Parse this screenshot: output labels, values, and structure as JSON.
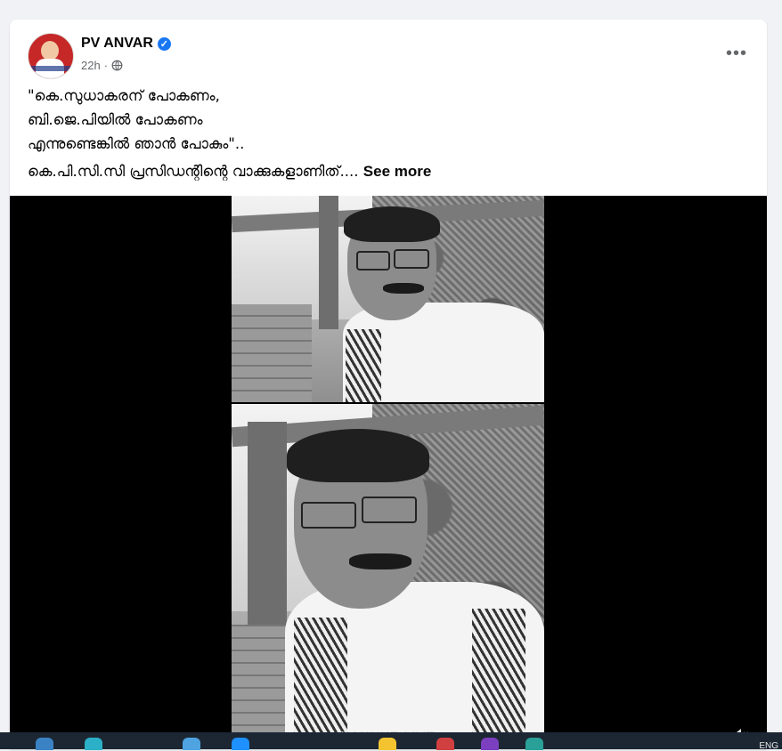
{
  "post": {
    "author": "PV ANVAR",
    "verified": true,
    "time": "22h",
    "privacy_icon": "globe-icon",
    "more_label": "•••",
    "text_lines": [
      "\"കെ.സുധാകരന് പോകണം,",
      "ബി.ജെ.പിയിൽ പോകണം",
      "എന്നുണ്ടെങ്കിൽ ഞാൻ പോകും\".."
    ],
    "text_last": "കെ.പി.സി.സി പ്രസിഡന്റിന്റെ വാക്കുകളാണിത്....",
    "see_more": "See more"
  },
  "video": {
    "watermark": "KANNUR LIVE",
    "mute_icon": "speaker-muted-icon"
  },
  "taskbar": {
    "lang": "ENG"
  },
  "colors": {
    "page_bg": "#f0f2f5",
    "verified": "#1877f2",
    "text": "#050505",
    "meta": "#65676b",
    "video_bg": "#000000"
  }
}
